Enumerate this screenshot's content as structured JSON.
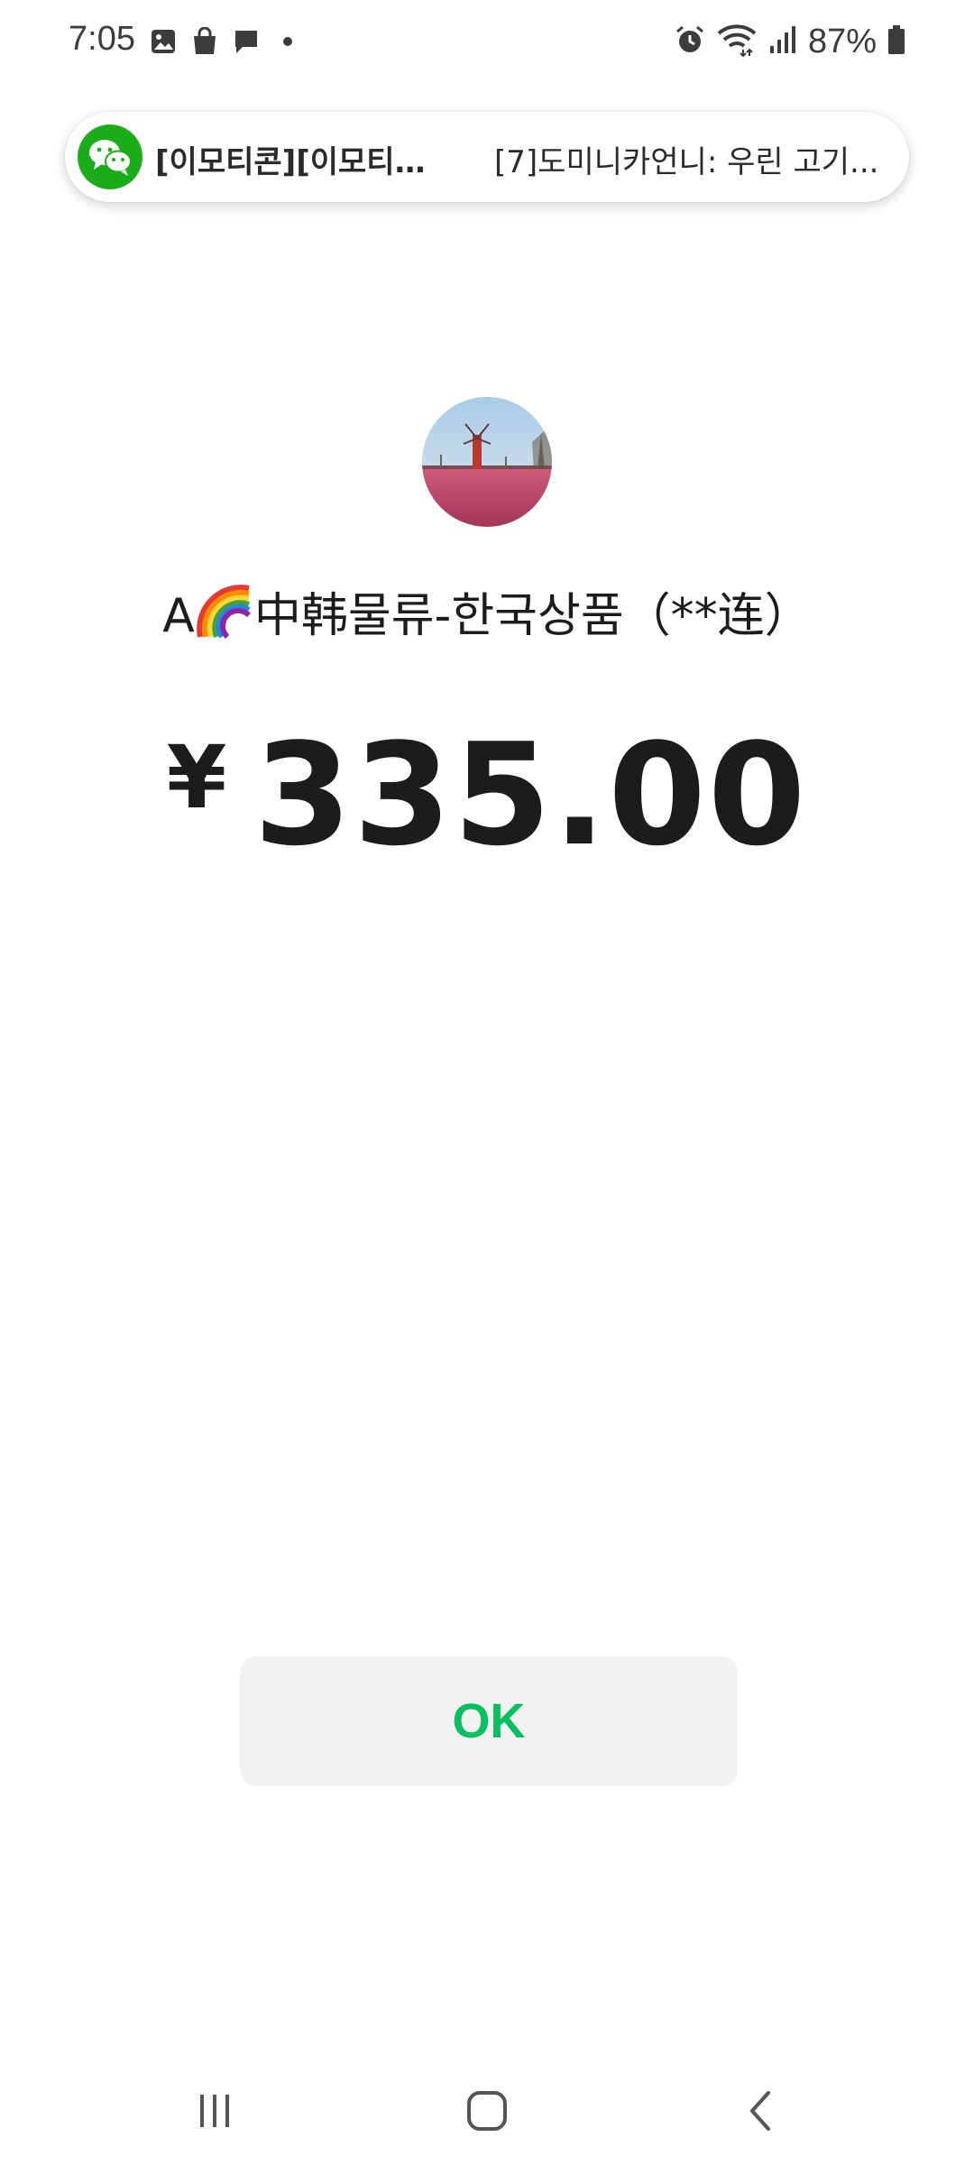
{
  "status_bar": {
    "time": "7:05",
    "left_icons": [
      "image-icon",
      "shopping-bag-icon",
      "chat-bubble-icon",
      "dot-icon"
    ],
    "right_icons": [
      "alarm-icon",
      "wifi-icon",
      "signal-icon",
      "battery-icon"
    ],
    "battery_percent": "87%"
  },
  "notification": {
    "app_icon": "wechat-icon",
    "title": "[이모티콘][이모티콘]...",
    "body": "[7]도미니카언니: 우린 고기..."
  },
  "payee": {
    "avatar": "windmill-photo",
    "name_prefix": "A",
    "name_emoji": "rainbow",
    "name_suffix": "中韩물류-한국상품（**连）"
  },
  "payment": {
    "currency_symbol": "¥",
    "amount": "335.00"
  },
  "actions": {
    "ok_label": "OK"
  },
  "nav_bar": {
    "buttons": [
      "recent-apps-icon",
      "home-icon",
      "back-icon"
    ]
  },
  "colors": {
    "accent_green": "#07c160",
    "wechat_green": "#1aad19",
    "button_bg": "#f2f2f2",
    "text_primary": "#1c1c1c"
  }
}
